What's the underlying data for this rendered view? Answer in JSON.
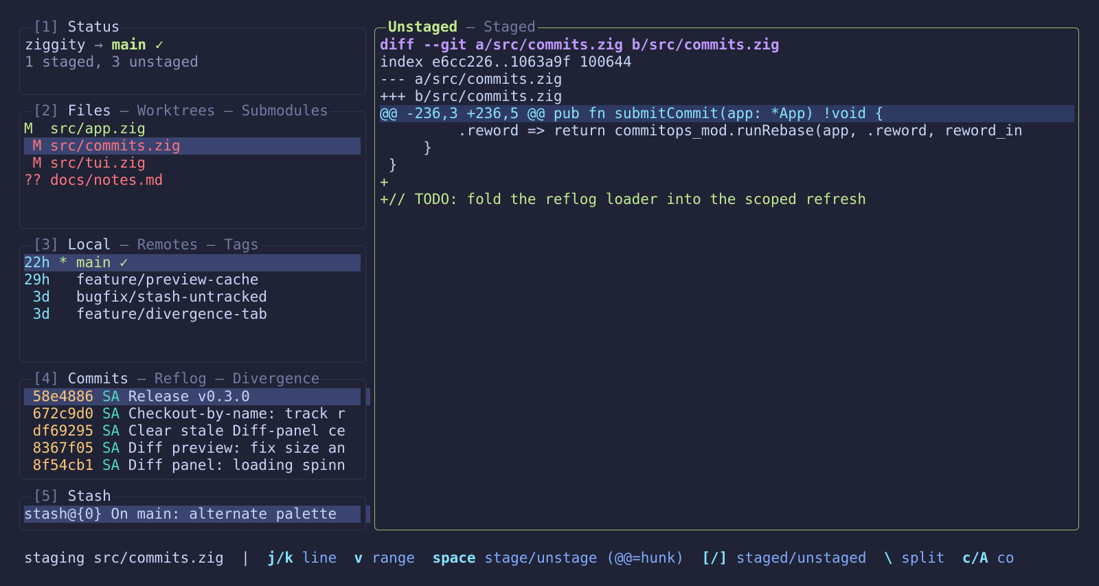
{
  "status_panel": {
    "title_index": "[1]",
    "title": "Status",
    "repo": "ziggity",
    "arrow": "→",
    "branch": "main",
    "check": "✓",
    "summary": "1 staged, 3 unstaged"
  },
  "files_panel": {
    "title_index": "[2]",
    "tabs": [
      "Files",
      "Worktrees",
      "Submodules"
    ],
    "separator": " – ",
    "items": [
      {
        "status": "M ",
        "path": "src/app.zig"
      },
      {
        "status": " M",
        "path": "src/commits.zig"
      },
      {
        "status": " M",
        "path": "src/tui.zig"
      },
      {
        "status": "??",
        "path": "docs/notes.md"
      }
    ]
  },
  "branches_panel": {
    "title_index": "[3]",
    "tabs": [
      "Local",
      "Remotes",
      "Tags"
    ],
    "items": [
      {
        "age": "22h",
        "marker": "*",
        "name": "main",
        "check": "✓"
      },
      {
        "age": "29h",
        "marker": " ",
        "name": "feature/preview-cache"
      },
      {
        "age": " 3d",
        "marker": " ",
        "name": "bugfix/stash-untracked"
      },
      {
        "age": " 3d",
        "marker": " ",
        "name": "feature/divergence-tab"
      }
    ]
  },
  "commits_panel": {
    "title_index": "[4]",
    "tabs": [
      "Commits",
      "Reflog",
      "Divergence"
    ],
    "items": [
      {
        "hash": "58e4886",
        "author": "SA",
        "msg": "Release v0.3.0"
      },
      {
        "hash": "672c9d0",
        "author": "SA",
        "msg": "Checkout-by-name: track r"
      },
      {
        "hash": "df69295",
        "author": "SA",
        "msg": "Clear stale Diff-panel ce"
      },
      {
        "hash": "8367f05",
        "author": "SA",
        "msg": "Diff preview: fix size an"
      },
      {
        "hash": "8f54cb1",
        "author": "SA",
        "msg": "Diff panel: loading spinn"
      }
    ]
  },
  "stash_panel": {
    "title_index": "[5]",
    "title": "Stash",
    "items": [
      {
        "text": "stash@{0} On main: alternate palette"
      }
    ]
  },
  "diff_panel": {
    "tab_active": "Unstaged",
    "tab_other": "Staged",
    "separator": " – ",
    "lines": [
      {
        "type": "header",
        "text": "diff --git a/src/commits.zig b/src/commits.zig"
      },
      {
        "type": "meta",
        "text": "index e6cc226..1063a9f 100644"
      },
      {
        "type": "meta",
        "text": "--- a/src/commits.zig"
      },
      {
        "type": "meta",
        "text": "+++ b/src/commits.zig"
      },
      {
        "type": "hunk",
        "text": "@@ -236,3 +236,5 @@ pub fn submitCommit(app: *App) !void {"
      },
      {
        "type": "context",
        "text": "         .reword => return commitops_mod.runRebase(app, .reword, reword_in"
      },
      {
        "type": "context",
        "text": "     }"
      },
      {
        "type": "context",
        "text": " }"
      },
      {
        "type": "add",
        "text": "+"
      },
      {
        "type": "add",
        "text": "+// TODO: fold the reflog loader into the scoped refresh"
      }
    ]
  },
  "footer": {
    "context": "staging src/commits.zig",
    "divider": "|",
    "hints": [
      {
        "key": "j/k",
        "desc": "line"
      },
      {
        "key": "v",
        "desc": "range"
      },
      {
        "key": "space",
        "desc": "stage/unstage (@@=hunk)"
      },
      {
        "key": "[/]",
        "desc": "staged/unstaged"
      },
      {
        "key": "\\",
        "desc": "split"
      },
      {
        "key": "c/A",
        "desc": "co"
      }
    ]
  },
  "colors": {
    "background": "#1f2335",
    "active_border": "#9fb86a",
    "selection": "#3b4470",
    "added": "#c3e88d",
    "modified": "#ff757f",
    "hash": "#ffc777",
    "author": "#4fd6be",
    "diff_header": "#c099ff"
  }
}
